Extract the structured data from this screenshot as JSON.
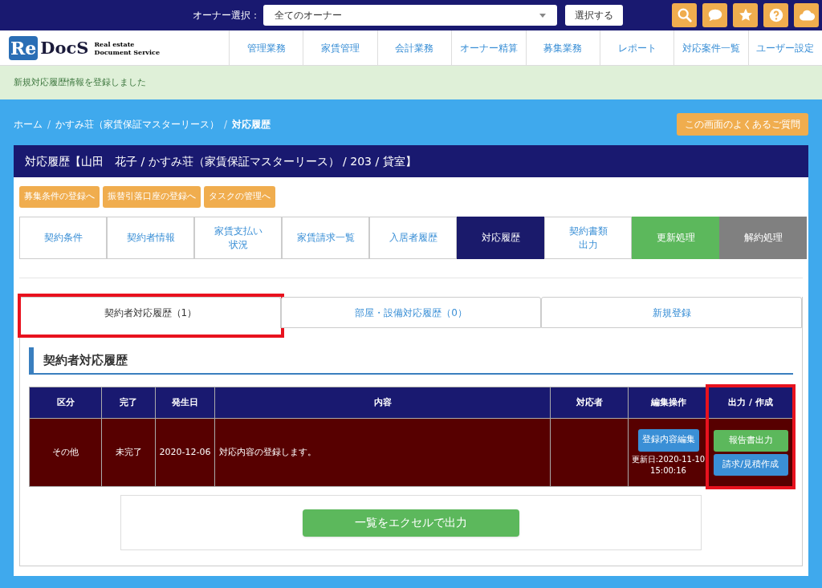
{
  "header": {
    "owner_label": "オーナー選択：",
    "owner_select": "全てのオーナー",
    "select_button": "選択する"
  },
  "logo": {
    "mark": "Re",
    "name": "DocS",
    "tagline_1": "Real estate",
    "tagline_2": "Document Service"
  },
  "nav": [
    "管理業務",
    "家賃管理",
    "会計業務",
    "オーナー精算",
    "募集業務",
    "レポート",
    "対応案件一覧",
    "ユーザー設定"
  ],
  "message": "新規対応履歴情報を登録しました",
  "breadcrumb_separator": "/",
  "breadcrumb": [
    {
      "label": "ホーム",
      "current": false
    },
    {
      "label": "かすみ荘（家賃保証マスターリース）",
      "current": false
    },
    {
      "label": "対応履歴",
      "current": true
    }
  ],
  "faq_button": "この画面のよくあるご質問",
  "panel_title": "対応履歴【山田　花子 / かすみ荘（家賃保証マスターリース） / 203 / 貸室】",
  "action_buttons": [
    "募集条件の登録へ",
    "振替引落口座の登録へ",
    "タスクの管理へ"
  ],
  "tabs": [
    {
      "label": "契約条件",
      "kind": "normal",
      "selected": false
    },
    {
      "label": "契約者情報",
      "kind": "normal",
      "selected": false
    },
    {
      "lines": [
        "家賃支払い",
        "状況"
      ],
      "kind": "normal",
      "selected": false
    },
    {
      "label": "家賃請求一覧",
      "kind": "normal",
      "selected": false
    },
    {
      "label": "入居者履歴",
      "kind": "normal",
      "selected": false
    },
    {
      "label": "対応履歴",
      "kind": "normal",
      "selected": true
    },
    {
      "lines": [
        "契約書類",
        "出力"
      ],
      "kind": "normal",
      "selected": false
    },
    {
      "label": "更新処理",
      "kind": "renew",
      "selected": false
    },
    {
      "label": "解約処理",
      "kind": "cancel",
      "selected": false
    }
  ],
  "sub_tabs": [
    {
      "label": "契約者対応履歴（1）",
      "selected": true,
      "highlighted": true
    },
    {
      "label": "部屋・設備対応履歴（0）",
      "selected": false,
      "highlighted": false
    },
    {
      "label": "新規登録",
      "selected": false,
      "highlighted": false
    }
  ],
  "section_title": "契約者対応履歴",
  "table": {
    "columns": [
      {
        "label": "区分",
        "highlighted": false
      },
      {
        "label": "完了",
        "highlighted": false
      },
      {
        "label": "発生日",
        "highlighted": false
      },
      {
        "label": "内容",
        "highlighted": false
      },
      {
        "label": "対応者",
        "highlighted": false
      },
      {
        "label": "編集操作",
        "highlighted": false
      },
      {
        "label": "出力 / 作成",
        "highlighted": true
      }
    ],
    "rows": [
      {
        "category": "その他",
        "done": "未完了",
        "date": "2020-12-06",
        "content": "対応内容の登録します。",
        "edit_button": "登録内容編集",
        "updated_1": "更新日:2020-11-10",
        "updated_2": "15:00:16",
        "report_button": "報告書出力",
        "estimate_button": "請求/見積作成"
      }
    ]
  },
  "excel_button": "一覧をエクセルで出力"
}
